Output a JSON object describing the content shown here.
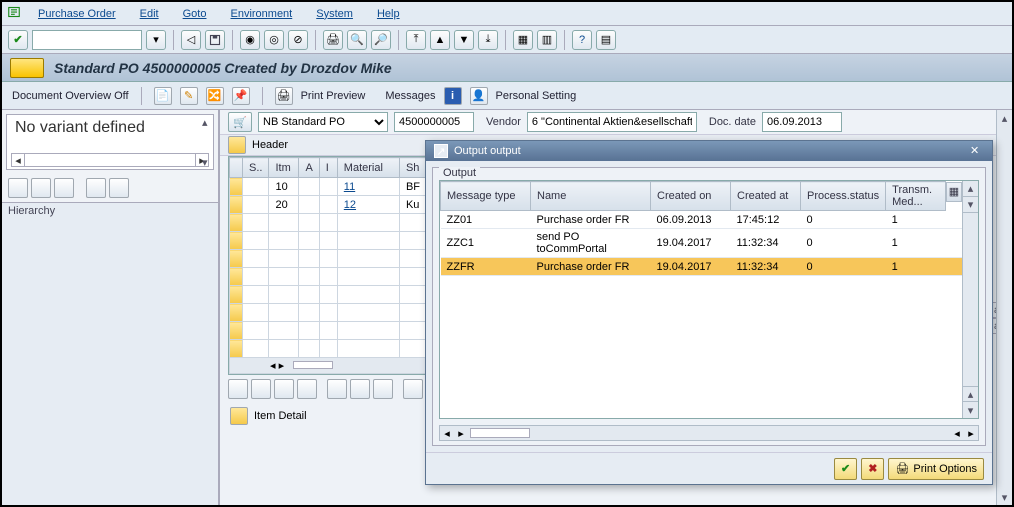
{
  "menu": [
    "Purchase Order",
    "Edit",
    "Goto",
    "Environment",
    "System",
    "Help"
  ],
  "title": "Standard PO 4500000005 Created by Drozdov Mike",
  "apptb": {
    "doc_overview": "Document Overview Off",
    "print_preview": "Print Preview",
    "messages": "Messages",
    "personal": "Personal Setting"
  },
  "left": {
    "variant": "No variant defined",
    "hierarchy": "Hierarchy"
  },
  "po": {
    "type": "NB Standard PO",
    "number": "4500000005",
    "vendor_lbl": "Vendor",
    "vendor_val": "6 \"Continental Aktien&esellschaft",
    "docdate_lbl": "Doc. date",
    "docdate_val": "06.09.2013",
    "header_lbl": "Header",
    "item_detail": "Item Detail"
  },
  "items": {
    "cols": [
      "S..",
      "Itm",
      "A",
      "I",
      "Material",
      "Sh"
    ],
    "rows": [
      {
        "itm": "10",
        "material": "11",
        "sh": "BF"
      },
      {
        "itm": "20",
        "material": "12",
        "sh": "Ku"
      }
    ]
  },
  "popup": {
    "title": "Output output",
    "group": "Output",
    "cols": [
      "Message type",
      "Name",
      "Created on",
      "Created at",
      "Process.status",
      "Transm. Med..."
    ],
    "rows": [
      {
        "mt": "ZZ01",
        "name": "Purchase order FR",
        "cd": "06.09.2013",
        "ct": "17:45:12",
        "ps": "0",
        "tm": "1",
        "sel": false
      },
      {
        "mt": "ZZC1",
        "name": "send PO toCommPortal",
        "cd": "19.04.2017",
        "ct": "11:32:34",
        "ps": "0",
        "tm": "1",
        "sel": false
      },
      {
        "mt": "ZZFR",
        "name": "Purchase order FR",
        "cd": "19.04.2017",
        "ct": "11:32:34",
        "ps": "0",
        "tm": "1",
        "sel": true
      }
    ],
    "print_options": "Print Options"
  },
  "rtabs": [
    "ans",
    "ans"
  ]
}
